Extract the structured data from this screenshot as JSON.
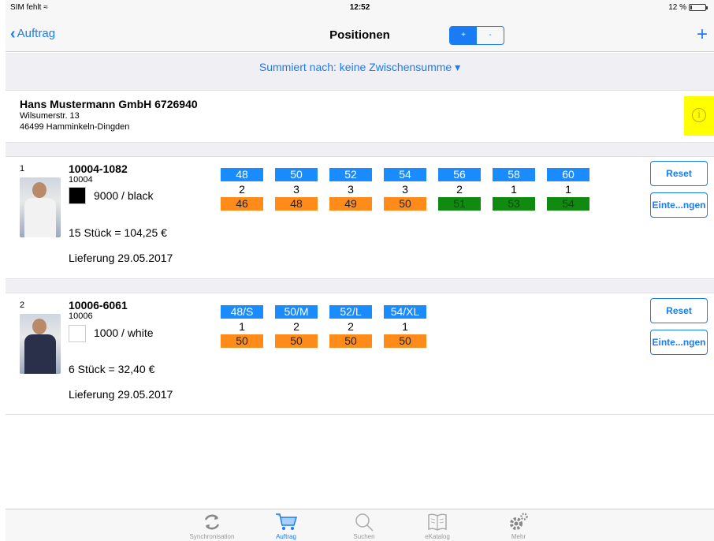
{
  "status": {
    "carrier": "SIM fehlt",
    "time": "12:52",
    "battery": "12 %",
    "battery_level": 0.12
  },
  "nav": {
    "back_label": "Auftrag",
    "title": "Positionen",
    "seg_left": "+",
    "seg_right": "-",
    "add_label": "+"
  },
  "summary": {
    "label": "Summiert nach: keine Zwischensumme ▾"
  },
  "customer": {
    "name": "Hans Mustermann GmbH 6726940",
    "street": "Wilsumerstr. 13",
    "city": "46499 Hamminkeln-Dingden",
    "info_icon": "i"
  },
  "positions": [
    {
      "num": "1",
      "article": "10004-1082",
      "sub": "10004",
      "color_hex": "#000000",
      "color_label": "9000 / black",
      "total": "15 Stück = 104,25 €",
      "delivery": "Lieferung 29.05.2017",
      "shirt_color": "#f2f2f2",
      "sizes": [
        {
          "size": "48",
          "qty": "2",
          "stock": "46",
          "status": "orange"
        },
        {
          "size": "50",
          "qty": "3",
          "stock": "48",
          "status": "orange"
        },
        {
          "size": "52",
          "qty": "3",
          "stock": "49",
          "status": "orange"
        },
        {
          "size": "54",
          "qty": "3",
          "stock": "50",
          "status": "orange"
        },
        {
          "size": "56",
          "qty": "2",
          "stock": "51",
          "status": "green"
        },
        {
          "size": "58",
          "qty": "1",
          "stock": "53",
          "status": "green"
        },
        {
          "size": "60",
          "qty": "1",
          "stock": "54",
          "status": "green"
        }
      ],
      "reset_label": "Reset",
      "settings_label": "Einte...ngen"
    },
    {
      "num": "2",
      "article": "10006-6061",
      "sub": "10006",
      "color_hex": "#ffffff",
      "color_label": "1000 / white",
      "total": "6 Stück = 32,40 €",
      "delivery": "Lieferung 29.05.2017",
      "shirt_color": "#2a2f4a",
      "sizes": [
        {
          "size": "48/S",
          "qty": "1",
          "stock": "50",
          "status": "orange"
        },
        {
          "size": "50/M",
          "qty": "2",
          "stock": "50",
          "status": "orange"
        },
        {
          "size": "52/L",
          "qty": "2",
          "stock": "50",
          "status": "orange"
        },
        {
          "size": "54/XL",
          "qty": "1",
          "stock": "50",
          "status": "orange"
        }
      ],
      "reset_label": "Reset",
      "settings_label": "Einte...ngen"
    }
  ],
  "tabs": [
    {
      "label": "Synchronisation",
      "icon": "sync-icon"
    },
    {
      "label": "Auftrag",
      "icon": "cart-icon"
    },
    {
      "label": "Suchen",
      "icon": "search-icon"
    },
    {
      "label": "eKatalog",
      "icon": "book-icon"
    },
    {
      "label": "Mehr",
      "icon": "gear-icon"
    }
  ],
  "colors": {
    "accent": "#1a7cf5",
    "size_blue": "#1a8cff",
    "stock_orange": "#ff8c1a",
    "stock_green": "#108a10",
    "info_yellow": "#ffff00"
  }
}
